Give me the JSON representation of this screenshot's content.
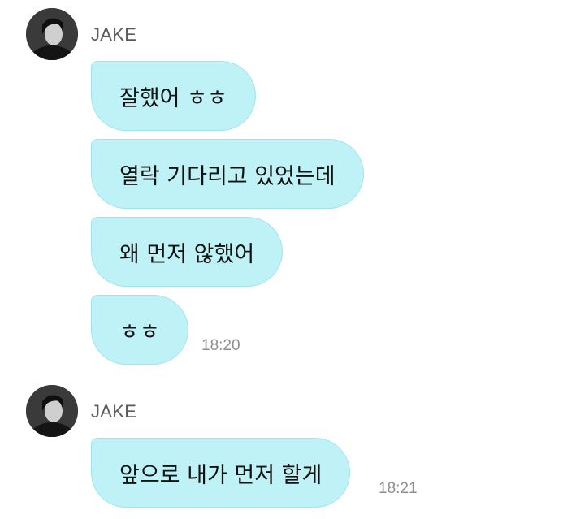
{
  "groups": [
    {
      "sender": "JAKE",
      "messages": [
        {
          "text": "잘했어 ㅎㅎ"
        },
        {
          "text": "열락 기다리고 있었는데"
        },
        {
          "text": "왜 먼저 않했어"
        },
        {
          "text": "ㅎㅎ"
        }
      ],
      "time": "18:20"
    },
    {
      "sender": "JAKE",
      "messages": [
        {
          "text": "앞으로 내가 먼저 할게"
        }
      ],
      "time": "18:21"
    }
  ],
  "colors": {
    "bubble": "#bff2f6",
    "bubble_border": "#9fe6ec",
    "sender": "#5a5a5a",
    "time": "#8e8e8e"
  },
  "icons": {
    "avatar": "profile-photo"
  }
}
